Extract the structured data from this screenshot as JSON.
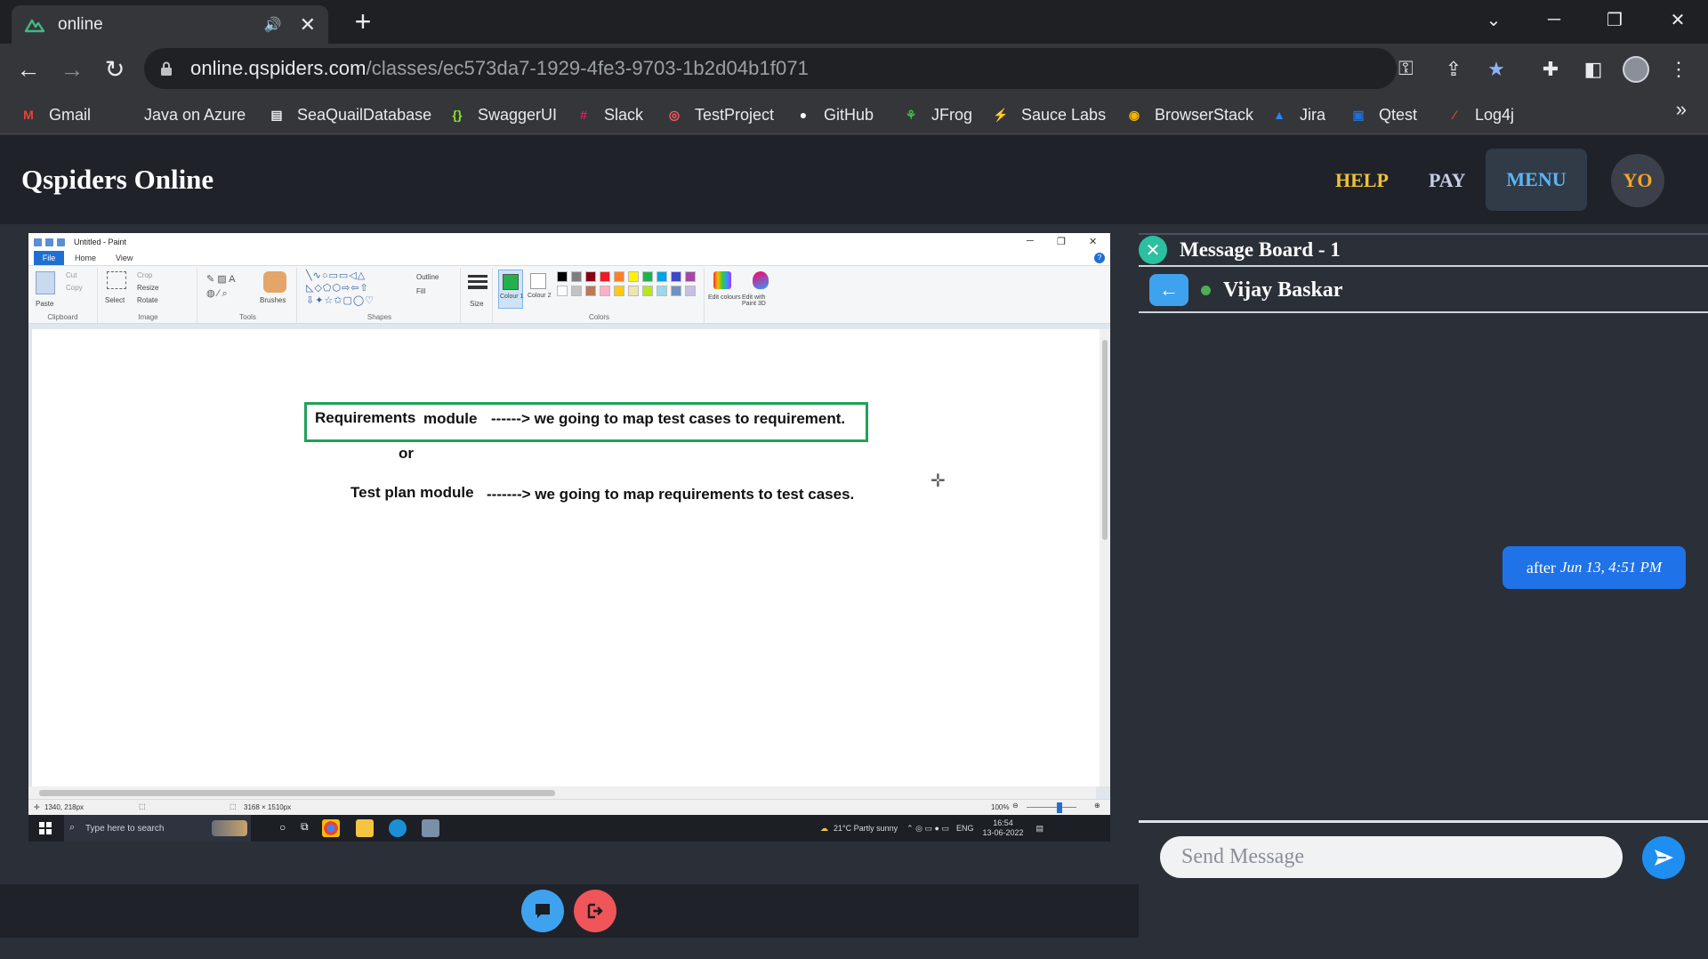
{
  "browser": {
    "tab_title": "online",
    "url_host": "online.qspiders.com",
    "url_path": "/classes/ec573da7-1929-4fe3-9703-1b2d04b1f071",
    "bookmarks": [
      {
        "label": "Gmail",
        "icon": "gmail-icon",
        "color": "#ea4335"
      },
      {
        "label": "Java on Azure",
        "icon": "microsoft-icon",
        "color": "#f25022"
      },
      {
        "label": "SeaQuailDatabase",
        "icon": "document-icon",
        "color": "#e8eaed"
      },
      {
        "label": "SwaggerUI",
        "icon": "swagger-icon",
        "color": "#85ea2d"
      },
      {
        "label": "Slack",
        "icon": "slack-icon",
        "color": "#e01e5a"
      },
      {
        "label": "TestProject",
        "icon": "testproject-icon",
        "color": "#ff5a5f"
      },
      {
        "label": "GitHub",
        "icon": "github-icon",
        "color": "#ffffff"
      },
      {
        "label": "JFrog",
        "icon": "jfrog-icon",
        "color": "#40be46"
      },
      {
        "label": "Sauce Labs",
        "icon": "saucelabs-icon",
        "color": "#e2231a"
      },
      {
        "label": "BrowserStack",
        "icon": "browserstack-icon",
        "color": "#f7b500"
      },
      {
        "label": "Jira",
        "icon": "jira-icon",
        "color": "#2684ff"
      },
      {
        "label": "Qtest",
        "icon": "qtest-icon",
        "color": "#1f6fd1"
      },
      {
        "label": "Log4j",
        "icon": "feather-icon",
        "color": "#d8453a"
      }
    ],
    "more_label": "»"
  },
  "app": {
    "brand": "Qspiders Online",
    "help_label": "HELP",
    "pay_label": "PAY",
    "menu_label": "MENU",
    "avatar_initials": "YO",
    "colors": {
      "help": "#f0c23a",
      "pay": "#c7cde8",
      "menu": "#5ab6f5",
      "avatar": "#f0a52a"
    }
  },
  "paint": {
    "window_title": "Untitled - Paint",
    "tabs": [
      "File",
      "Home",
      "View"
    ],
    "groups": [
      "Clipboard",
      "Image",
      "Tools",
      "Shapes",
      "Colors"
    ],
    "ribbon_labels": {
      "paste": "Paste",
      "cut": "Cut",
      "copy": "Copy",
      "select": "Select",
      "crop": "Crop",
      "resize": "Resize",
      "rotate": "Rotate",
      "brushes": "Brushes",
      "outline": "Outline",
      "fill": "Fill",
      "size": "Size",
      "color1": "Colour 1",
      "color2": "Colour 2",
      "edit_colors": "Edit colours",
      "paint3d": "Edit with Paint 3D"
    },
    "canvas_text": {
      "req_word": "Requirements",
      "module_word": "module",
      "req_arrow": "------> we going to map test cases to requirement.",
      "or": "or",
      "tp_module": "Test plan module",
      "tp_arrow": "-------> we going to map requirements to test cases."
    },
    "status": {
      "cursor": "1340, 218px",
      "canvas_size": "3168 × 1510px",
      "zoom": "100%"
    },
    "taskbar": {
      "search_placeholder": "Type here to search",
      "weather": "21°C  Partly sunny",
      "lang": "ENG",
      "time": "16:54",
      "date": "13-06-2022"
    },
    "palette": [
      "#000000",
      "#7f7f7f",
      "#880015",
      "#ed1c24",
      "#ff7f27",
      "#fff200",
      "#22b14c",
      "#00a2e8",
      "#3f48cc",
      "#a349a4",
      "#ffffff",
      "#c3c3c3",
      "#b97a57",
      "#ffaec9",
      "#ffc90e",
      "#efe4b0",
      "#b5e61d",
      "#99d9ea",
      "#7092be",
      "#c8bfe7"
    ]
  },
  "board": {
    "title": "Message Board - 1",
    "contact": "Vijay Baskar",
    "messages": [
      {
        "text": "after",
        "time": "Jun 13, 4:51 PM"
      }
    ],
    "send_placeholder": "Send Message"
  }
}
